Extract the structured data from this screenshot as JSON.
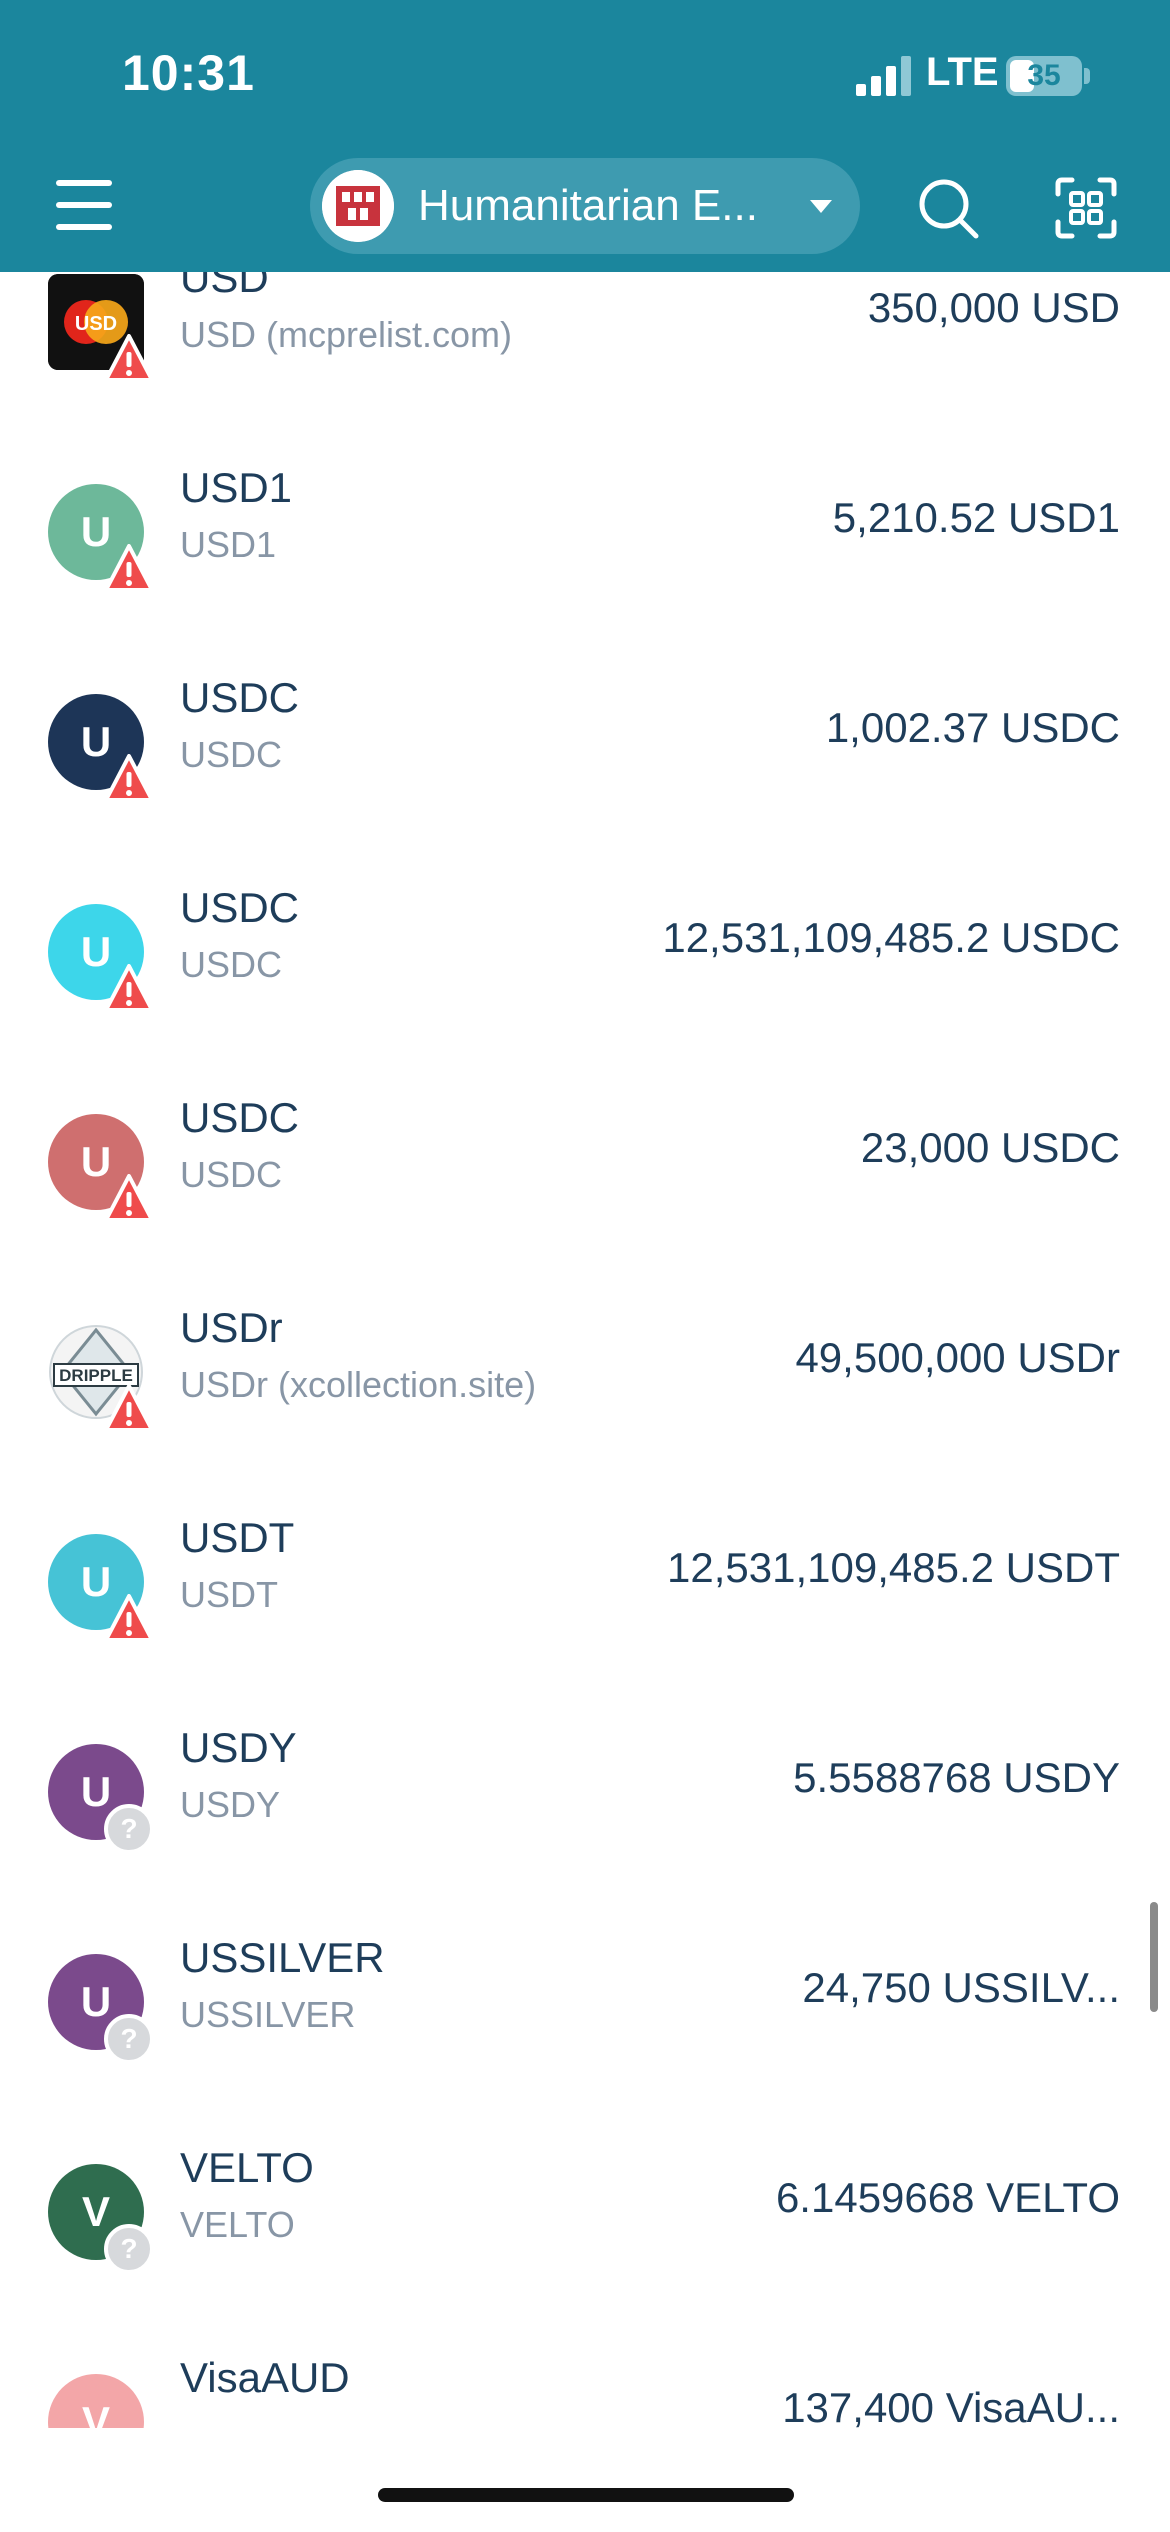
{
  "status_bar": {
    "time": "10:31",
    "network": "LTE",
    "battery": "35",
    "battery_level": 0.35
  },
  "header": {
    "wallet_name": "Humanitarian E...",
    "icons": [
      "menu-icon",
      "search-icon",
      "qr-scan-icon"
    ]
  },
  "tokens": [
    {
      "name": "USD",
      "sub": "USD (mcprelist.com)",
      "amount": "350,000 USD",
      "avatar_letter": "",
      "avatar_color": "#111111",
      "badge": "warning",
      "logo": "usd-logo"
    },
    {
      "name": "USD1",
      "sub": "USD1",
      "amount": "5,210.52 USD1",
      "avatar_letter": "U",
      "avatar_color": "#6db89a",
      "badge": "warning"
    },
    {
      "name": "USDC",
      "sub": "USDC",
      "amount": "1,002.37 USDC",
      "avatar_letter": "U",
      "avatar_color": "#1d3557",
      "badge": "warning"
    },
    {
      "name": "USDC",
      "sub": "USDC",
      "amount": "12,531,109,485.2 USDC",
      "avatar_letter": "U",
      "avatar_color": "#3dd6ea",
      "badge": "warning"
    },
    {
      "name": "USDC",
      "sub": "USDC",
      "amount": "23,000 USDC",
      "avatar_letter": "U",
      "avatar_color": "#cf6f6f",
      "badge": "warning"
    },
    {
      "name": "USDr",
      "sub": "USDr (xcollection.site)",
      "amount": "49,500,000 USDr",
      "avatar_letter": "",
      "avatar_color": "#ffffff",
      "badge": "warning",
      "logo": "dripple-logo"
    },
    {
      "name": "USDT",
      "sub": "USDT",
      "amount": "12,531,109,485.2 USDT",
      "avatar_letter": "U",
      "avatar_color": "#46c3d6",
      "badge": "warning"
    },
    {
      "name": "USDY",
      "sub": "USDY",
      "amount": "5.5588768 USDY",
      "avatar_letter": "U",
      "avatar_color": "#7b4a8c",
      "badge": "unknown"
    },
    {
      "name": "USSILVER",
      "sub": "USSILVER",
      "amount": "24,750 USSILV...",
      "avatar_letter": "U",
      "avatar_color": "#7b4a8c",
      "badge": "unknown"
    },
    {
      "name": "VELTO",
      "sub": "VELTO",
      "amount": "6.1459668 VELTO",
      "avatar_letter": "V",
      "avatar_color": "#2f6d4f",
      "badge": "unknown"
    },
    {
      "name": "VisaAUD",
      "sub": "",
      "amount": "137,400 VisaAU...",
      "avatar_letter": "V",
      "avatar_color": "#f3a6a8",
      "badge": "none"
    }
  ],
  "colors": {
    "header_bg": "#1b869d",
    "text_primary": "#1e3d5a",
    "text_secondary": "#8896a6",
    "warning": "#ef4b4b",
    "unknown_badge": "#d7d9dc"
  }
}
